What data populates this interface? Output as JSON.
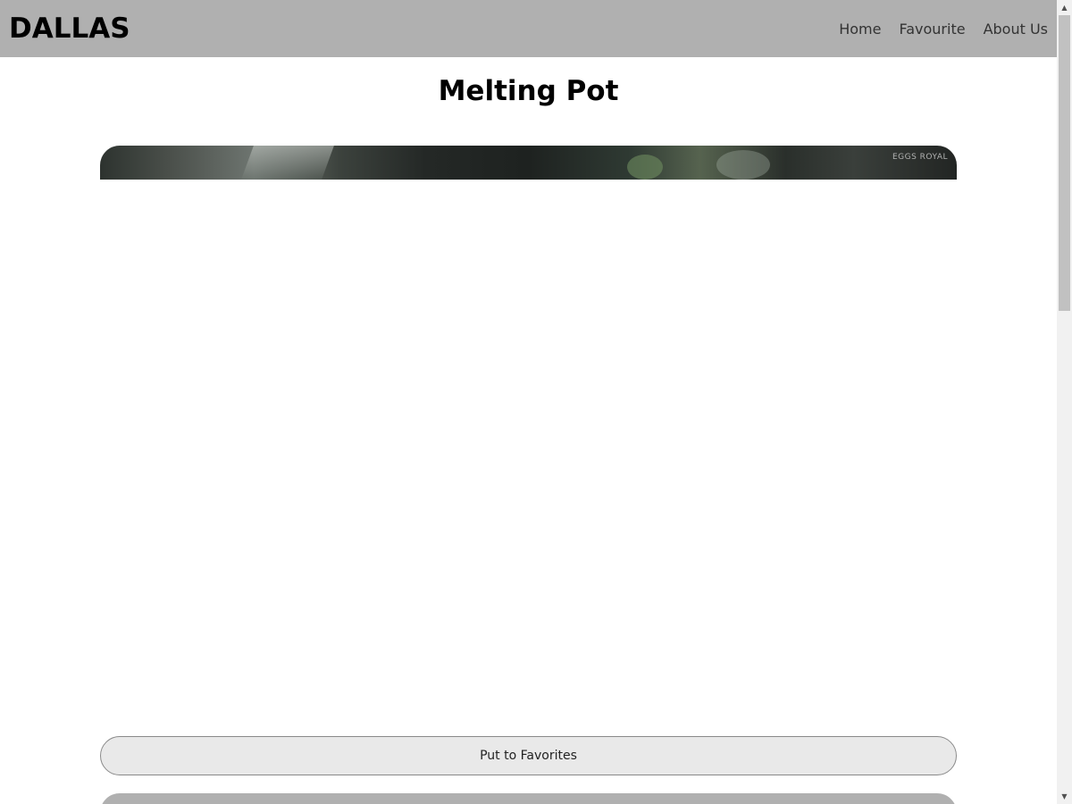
{
  "header": {
    "brand": "DALLAS",
    "nav": [
      "Home",
      "Favourite",
      "About Us"
    ]
  },
  "main": {
    "title": "Melting Pot",
    "photo_sign_text": "EGGS ROYAL",
    "favorite_button_label": "Put to Favorites"
  },
  "scrollbar": {
    "up_icon": "▲",
    "down_icon": "▼"
  },
  "colors": {
    "header_bg": "#b0b0b0",
    "button_bg": "#e9e9e9"
  }
}
